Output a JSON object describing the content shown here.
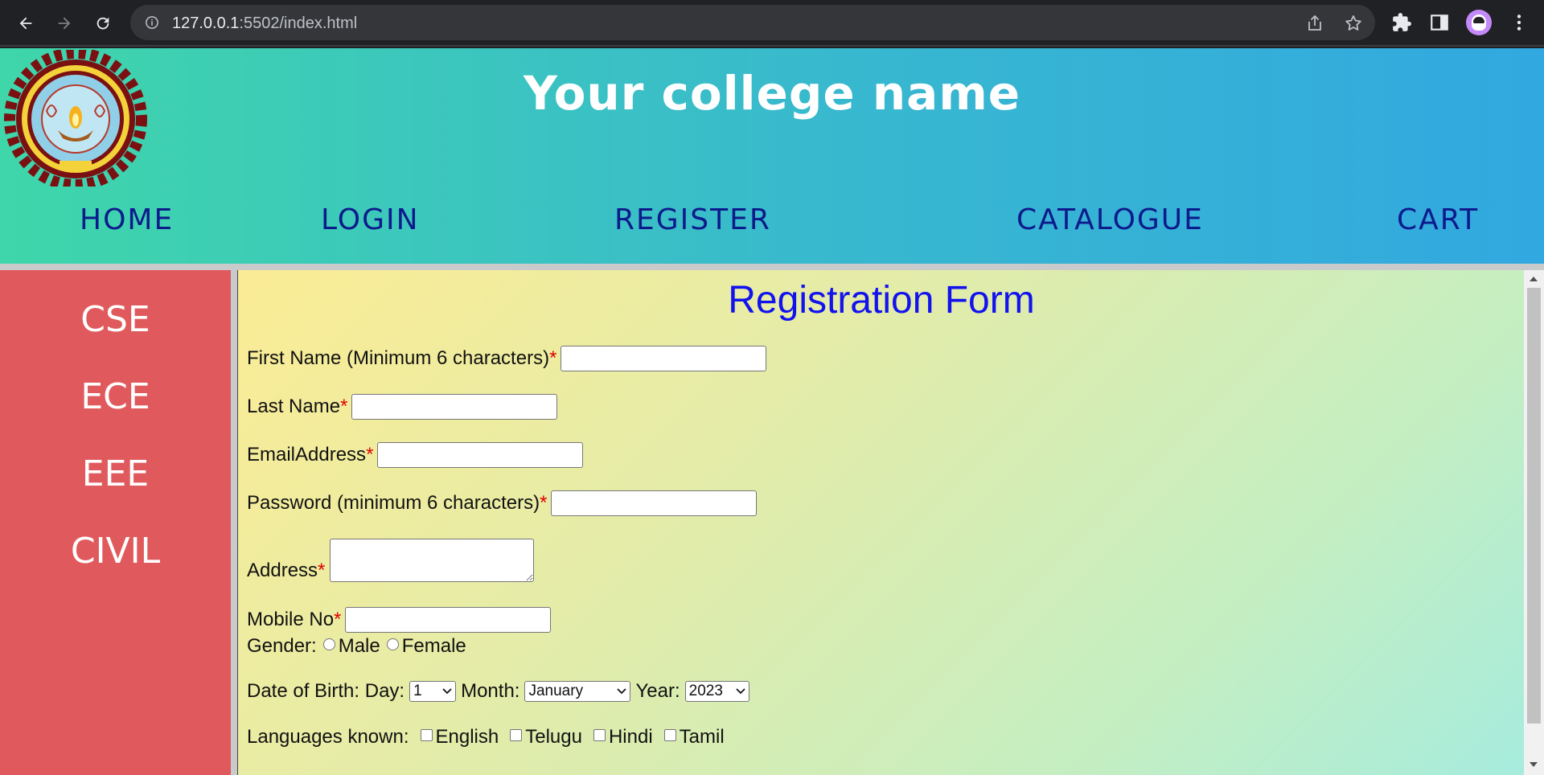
{
  "browser": {
    "url_host": "127.0.0.1",
    "url_rest": ":5502/index.html",
    "icons": [
      "back-arrow-icon",
      "forward-arrow-icon",
      "reload-icon",
      "info-icon",
      "share-icon",
      "star-icon",
      "extensions-icon",
      "side-panel-icon",
      "profile-avatar",
      "more-menu-icon"
    ]
  },
  "header": {
    "title": "Your college name",
    "logo_icon": "university-seal-logo"
  },
  "nav": {
    "items": [
      {
        "label": "HOME"
      },
      {
        "label": "LOGIN"
      },
      {
        "label": "REGISTER"
      },
      {
        "label": "CATALOGUE"
      },
      {
        "label": "CART"
      }
    ]
  },
  "sidebar": {
    "items": [
      {
        "label": "CSE"
      },
      {
        "label": "ECE"
      },
      {
        "label": "EEE"
      },
      {
        "label": "CIVIL"
      }
    ]
  },
  "form": {
    "title": "Registration Form",
    "first_name_label": "First Name (Minimum 6 characters)",
    "last_name_label": "Last Name",
    "email_label": "EmailAddress",
    "password_label": "Password (minimum 6 characters)",
    "address_label": "Address",
    "mobile_label": "Mobile No",
    "required_mark": "*",
    "gender_label": "Gender:",
    "gender_options": [
      "Male",
      "Female"
    ],
    "dob_label": "Date of Birth:",
    "day_label": "Day:",
    "day_value": "1",
    "month_label": "Month:",
    "month_value": "January",
    "year_label": "Year:",
    "year_value": "2023",
    "languages_label": "Languages known:",
    "languages": [
      "English",
      "Telugu",
      "Hindi",
      "Tamil"
    ]
  },
  "colors": {
    "header_gradient": [
      "#3fd6aa",
      "#32a8e0"
    ],
    "nav_text": "#0d1a8c",
    "sidebar_bg": "#e05a5d",
    "form_title": "#1212ee",
    "required": "#e00000"
  }
}
